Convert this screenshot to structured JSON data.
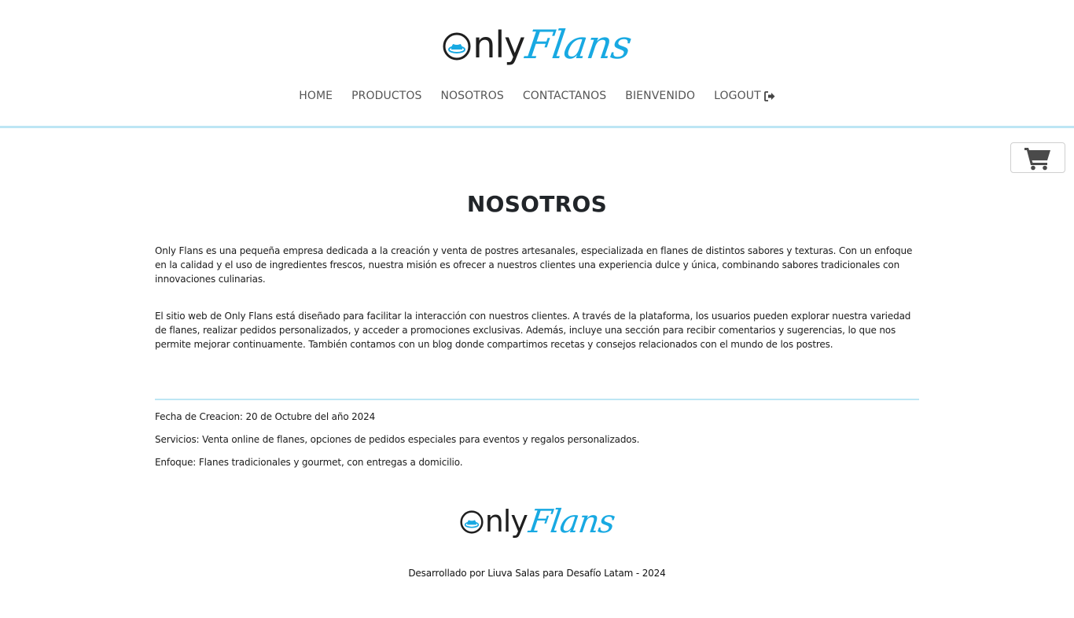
{
  "brand": {
    "only_text": "nly",
    "flans_text": "Flans",
    "accent_color": "#18a9e2",
    "divider_color": "#bde6f4"
  },
  "nav": {
    "items": [
      {
        "label": "HOME"
      },
      {
        "label": "PRODUCTOS"
      },
      {
        "label": "NOSOTROS"
      },
      {
        "label": "CONTACTANOS"
      },
      {
        "label": "BIENVENIDO"
      },
      {
        "label": "LOGOUT",
        "icon": "sign-out-icon"
      }
    ]
  },
  "cart": {
    "icon": "shopping-cart-icon"
  },
  "main": {
    "title": "NOSOTROS",
    "paragraphs": [
      "Only Flans es una pequeña empresa dedicada a la creación y venta de postres artesanales, especializada en flanes de distintos sabores y texturas. Con un enfoque en la calidad y el uso de ingredientes frescos, nuestra misión es ofrecer a nuestros clientes una experiencia dulce y única, combinando sabores tradicionales con innovaciones culinarias.",
      "El sitio web de Only Flans está diseñado para facilitar la interacción con nuestros clientes. A través de la plataforma, los usuarios pueden explorar nuestra variedad de flanes, realizar pedidos personalizados, y acceder a promociones exclusivas. Además, incluye una sección para recibir comentarios y sugerencias, lo que nos permite mejorar continuamente. También contamos con un blog donde compartimos recetas y consejos relacionados con el mundo de los postres."
    ],
    "info": [
      "Fecha de Creacion: 20 de Octubre del año 2024",
      "Servicios: Venta online de flanes, opciones de pedidos especiales para eventos y regalos personalizados.",
      "Enfoque: Flanes tradicionales y gourmet, con entregas a domicilio."
    ]
  },
  "footer": {
    "credit": "Desarrollado por Liuva Salas para Desafío Latam - 2024"
  }
}
